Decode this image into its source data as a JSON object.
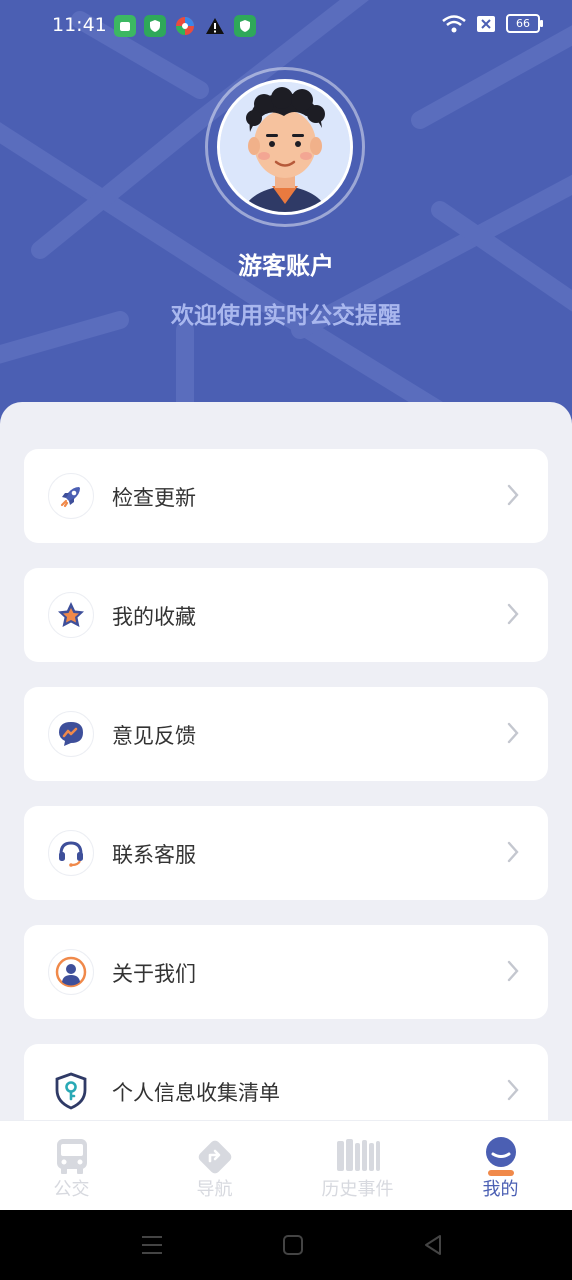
{
  "status_bar": {
    "time": "11:41",
    "battery": "66",
    "icons": [
      "app-icon-green",
      "shield-icon",
      "pinwheel-icon",
      "warning-icon",
      "shield-icon"
    ]
  },
  "profile": {
    "name": "游客账户",
    "welcome": "欢迎使用实时公交提醒"
  },
  "menu": {
    "items": [
      {
        "label": "检查更新",
        "icon": "rocket-icon"
      },
      {
        "label": "我的收藏",
        "icon": "star-icon"
      },
      {
        "label": "意见反馈",
        "icon": "chat-icon"
      },
      {
        "label": "联系客服",
        "icon": "headset-icon"
      },
      {
        "label": "关于我们",
        "icon": "user-circle-icon"
      },
      {
        "label": "个人信息收集清单",
        "icon": "shield-key-icon"
      }
    ]
  },
  "tabbar": {
    "tabs": [
      {
        "label": "公交",
        "icon": "bus-icon"
      },
      {
        "label": "导航",
        "icon": "navigation-icon"
      },
      {
        "label": "历史事件",
        "icon": "history-icon"
      },
      {
        "label": "我的",
        "icon": "profile-icon"
      }
    ],
    "active_index": 3
  },
  "colors": {
    "header": "#4b5fb3",
    "accent": "#4b5fb3",
    "tab_indicator": "#f0894a",
    "background": "#eeeff5"
  }
}
